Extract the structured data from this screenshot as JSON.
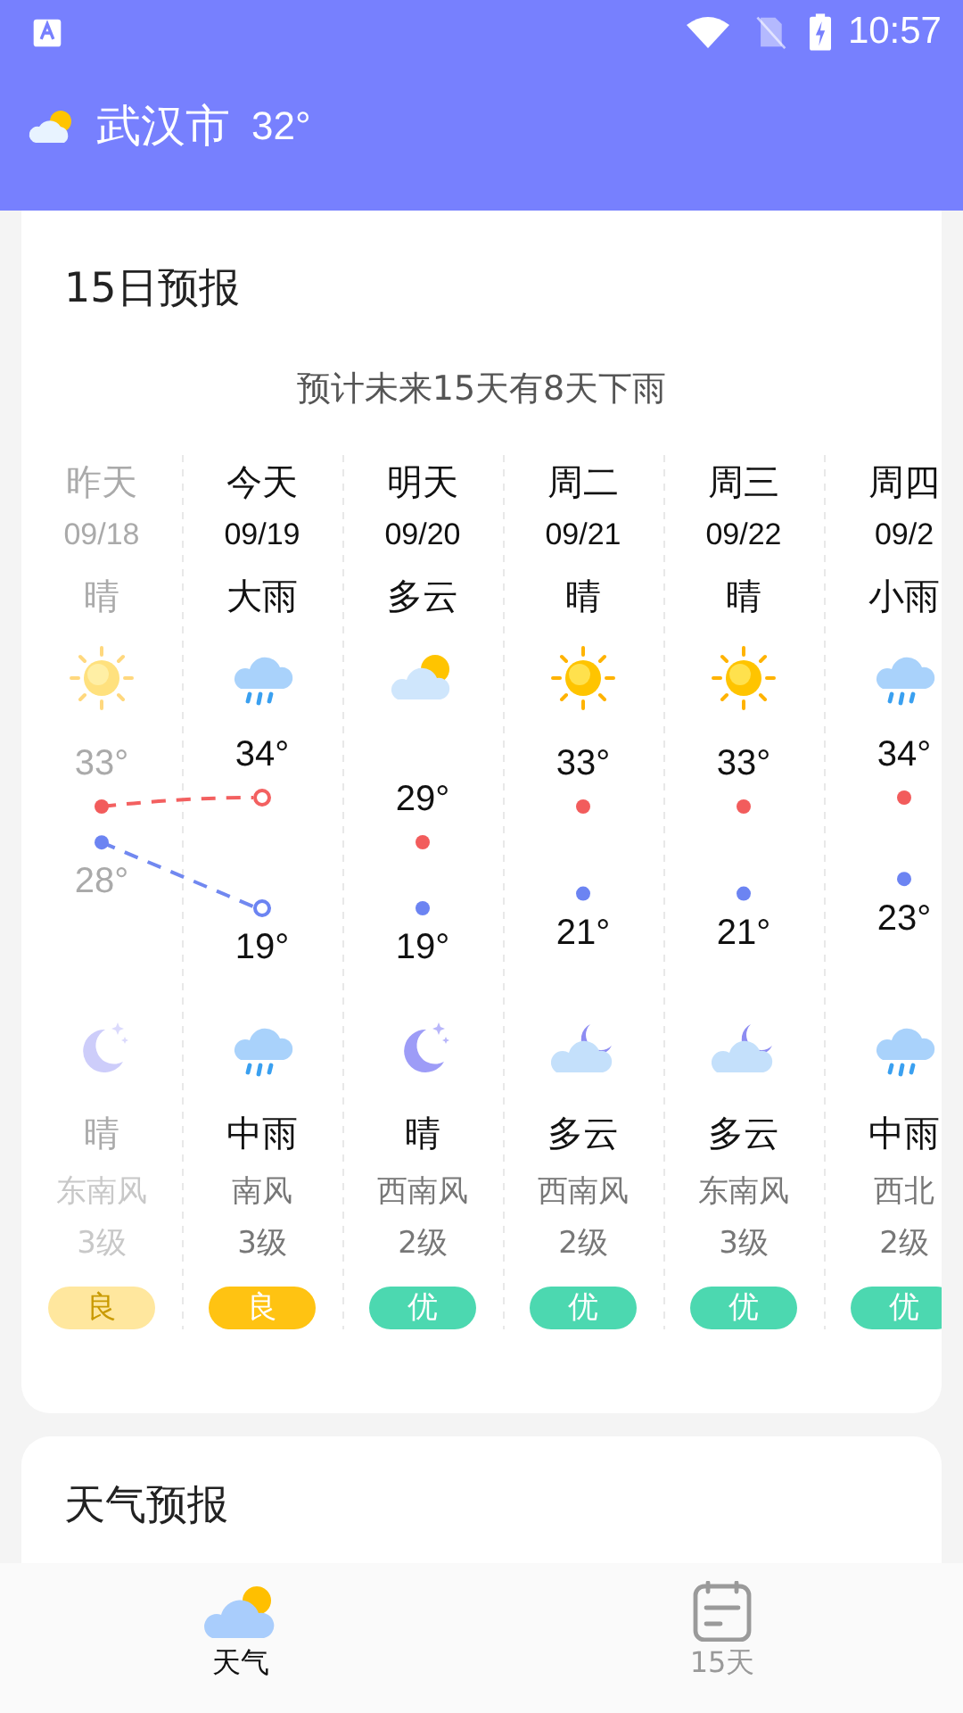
{
  "status_bar": {
    "time": "10:57"
  },
  "header": {
    "city": "武汉市",
    "temperature": "32°"
  },
  "forecast": {
    "title": "15日预报",
    "summary": "预计未来15天有8天下雨",
    "days": [
      {
        "day": "昨天",
        "date": "09/18",
        "day_weather": "晴",
        "day_icon": {
          "kind": "sun"
        },
        "high": "33°",
        "low": "28°",
        "night_icon": {
          "kind": "moon"
        },
        "night_weather": "晴",
        "wind": "东南风",
        "wind_level": "3级",
        "aqi": "良",
        "color": "#ffe79e",
        "past": true,
        "today": false
      },
      {
        "day": "今天",
        "date": "09/19",
        "day_weather": "大雨",
        "day_icon": {
          "kind": "rain"
        },
        "high": "34°",
        "low": "19°",
        "night_icon": {
          "kind": "rain"
        },
        "night_weather": "中雨",
        "wind": "南风",
        "wind_level": "3级",
        "aqi": "良",
        "color": "#ffc312",
        "past": false,
        "today": true
      },
      {
        "day": "明天",
        "date": "09/20",
        "day_weather": "多云",
        "day_icon": {
          "kind": "partly_cloudy"
        },
        "high": "29°",
        "low": "19°",
        "night_icon": {
          "kind": "moon"
        },
        "night_weather": "晴",
        "wind": "西南风",
        "wind_level": "2级",
        "aqi": "优",
        "color": "#4cd8b0",
        "past": false,
        "today": false
      },
      {
        "day": "周二",
        "date": "09/21",
        "day_weather": "晴",
        "day_icon": {
          "kind": "sun"
        },
        "high": "33°",
        "low": "21°",
        "night_icon": {
          "kind": "cloud_moon"
        },
        "night_weather": "多云",
        "wind": "西南风",
        "wind_level": "2级",
        "aqi": "优",
        "color": "#4cd8b0",
        "past": false,
        "today": false
      },
      {
        "day": "周三",
        "date": "09/22",
        "day_weather": "晴",
        "day_icon": {
          "kind": "sun"
        },
        "high": "33°",
        "low": "21°",
        "night_icon": {
          "kind": "cloud_moon"
        },
        "night_weather": "多云",
        "wind": "东南风",
        "wind_level": "3级",
        "aqi": "优",
        "color": "#4cd8b0",
        "past": false,
        "today": false
      },
      {
        "day": "周四",
        "date": "09/2",
        "day_weather": "小雨",
        "day_icon": {
          "kind": "rain"
        },
        "high": "34°",
        "low": "23°",
        "night_icon": {
          "kind": "rain"
        },
        "night_weather": "中雨",
        "wind": "西北",
        "wind_level": "2级",
        "aqi": "优",
        "color": "#4cd8b0",
        "past": false,
        "today": false
      }
    ]
  },
  "second_card": {
    "title": "天气预报"
  },
  "bottom_nav": [
    {
      "label": "天气",
      "kind": "weather",
      "selected": true
    },
    {
      "label": "15天",
      "kind": "calendar",
      "selected": false
    }
  ]
}
